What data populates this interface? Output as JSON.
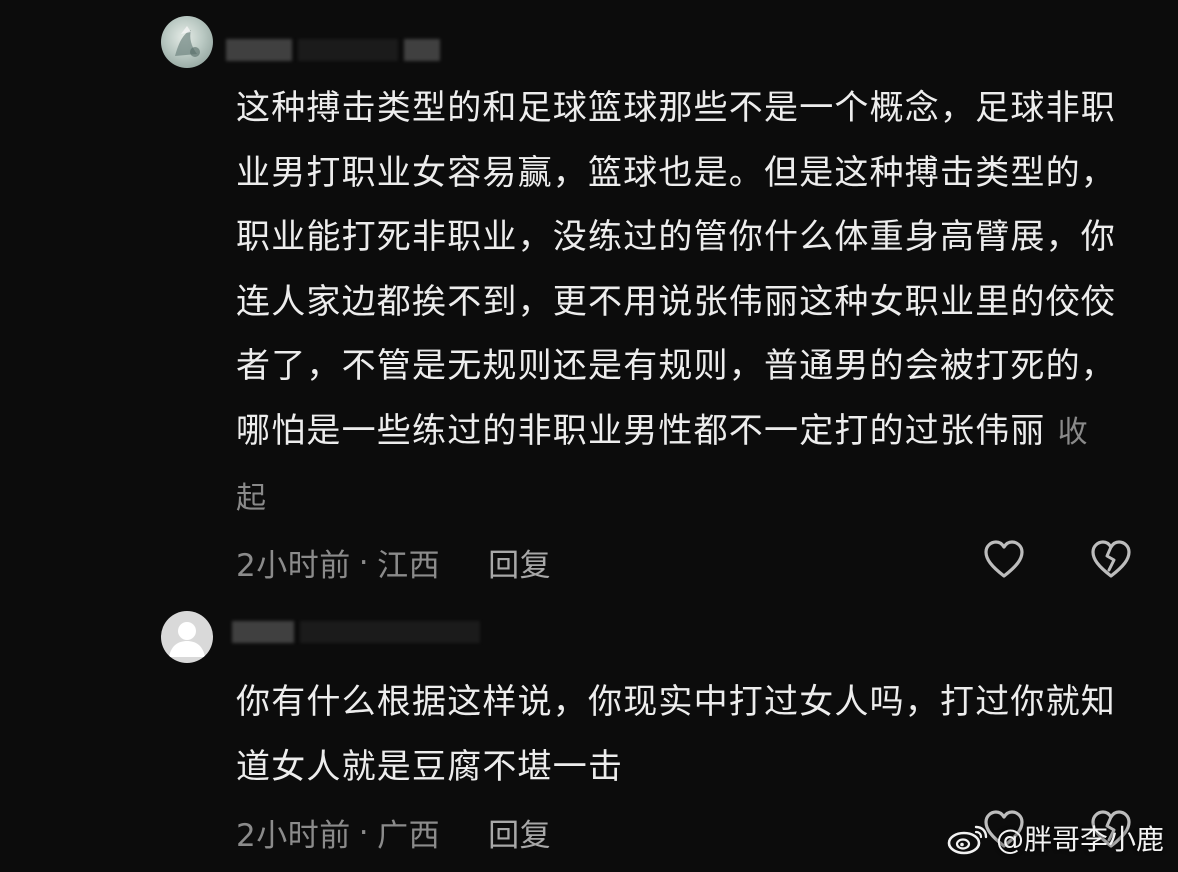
{
  "comments": [
    {
      "text": "这种搏击类型的和足球篮球那些不是一个概念，足球非职业男打职业女容易赢，篮球也是。但是这种搏击类型的，职业能打死非职业，没练过的管你什么体重身高臂展，你连人家边都挨不到，更不用说张伟丽这种女职业里的佼佼者了，不管是无规则还是有规则，普通男的会被打死的，哪怕是一些练过的非职业男性都不一定打的过张伟丽",
      "collapse_label": "收起",
      "time": "2小时前",
      "location": "江西",
      "separator": "·",
      "reply_label": "回复",
      "like_icon": "heart-outline-icon",
      "dislike_icon": "broken-heart-icon"
    },
    {
      "text": "你有什么根据这样说，你现实中打过女人吗，打过你就知道女人就是豆腐不堪一击",
      "time": "2小时前",
      "location": "广西",
      "separator": "·",
      "reply_label": "回复",
      "like_icon": "heart-outline-icon",
      "dislike_icon": "broken-heart-icon"
    }
  ],
  "watermark": {
    "text": "@胖哥李小鹿",
    "icon": "weibo-logo-icon"
  },
  "colors": {
    "background": "#0c0c0c",
    "text": "#ededed",
    "meta": "#8b8b8b",
    "icon": "#bdbdbd"
  }
}
